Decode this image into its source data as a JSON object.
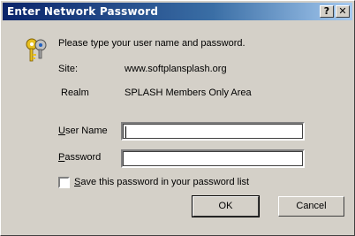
{
  "window": {
    "title": "Enter Network Password",
    "help_button": "?",
    "close_button": "✕"
  },
  "prompt": "Please type your user name and password.",
  "site": {
    "label": "Site:",
    "value": "www.softplansplash.org"
  },
  "realm": {
    "label": "Realm",
    "value": "SPLASH Members Only Area"
  },
  "username": {
    "label_accel": "U",
    "label_rest": "ser Name",
    "value": ""
  },
  "password": {
    "label_accel": "P",
    "label_rest": "assword",
    "value": ""
  },
  "save_password": {
    "label_accel": "S",
    "label_rest": "ave this password in your password list",
    "checked": false
  },
  "buttons": {
    "ok": "OK",
    "cancel": "Cancel"
  },
  "icons": {
    "dialog_icon": "keys-icon"
  }
}
